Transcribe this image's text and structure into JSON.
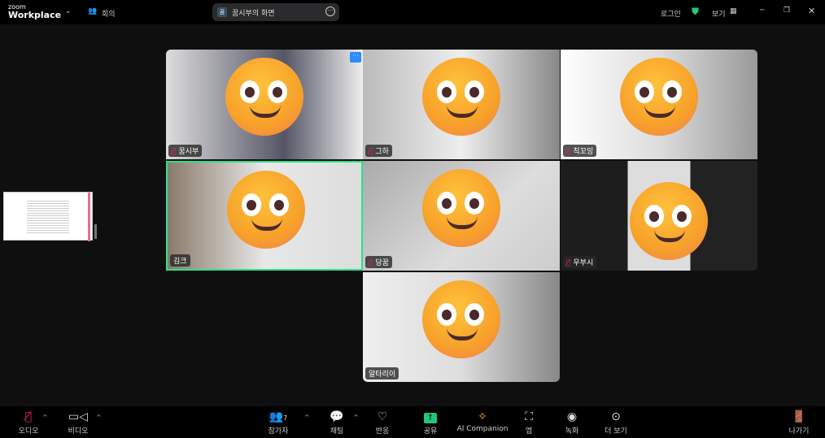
{
  "header": {
    "logo_small": "zoom",
    "logo_big": "Workplace",
    "meeting_label": "회의",
    "share_badge": "꿈",
    "share_title": "꿈시부의 화면",
    "login": "로그인",
    "view": "보기"
  },
  "participants": [
    {
      "name": "꿈시부",
      "muted": true
    },
    {
      "name": "그하",
      "muted": true
    },
    {
      "name": "칙꼬잉",
      "muted": true
    },
    {
      "name": "김크",
      "muted": false,
      "active_speaker": true
    },
    {
      "name": "당꿈",
      "muted": true
    },
    {
      "name": "우부시",
      "muted": true
    },
    {
      "name": "알타리이",
      "muted": false
    }
  ],
  "toolbar": {
    "audio": "오디오",
    "video": "비디오",
    "participants": "참가자",
    "participant_count": "7",
    "chat": "채팅",
    "reactions": "반응",
    "share": "공유",
    "ai": "AI Companion",
    "apps": "앱",
    "record": "녹화",
    "more": "더 보기",
    "leave": "나가기"
  },
  "colors": {
    "accent": "#22c77a",
    "active": "#2ee08a",
    "leave": "#e0245e"
  }
}
